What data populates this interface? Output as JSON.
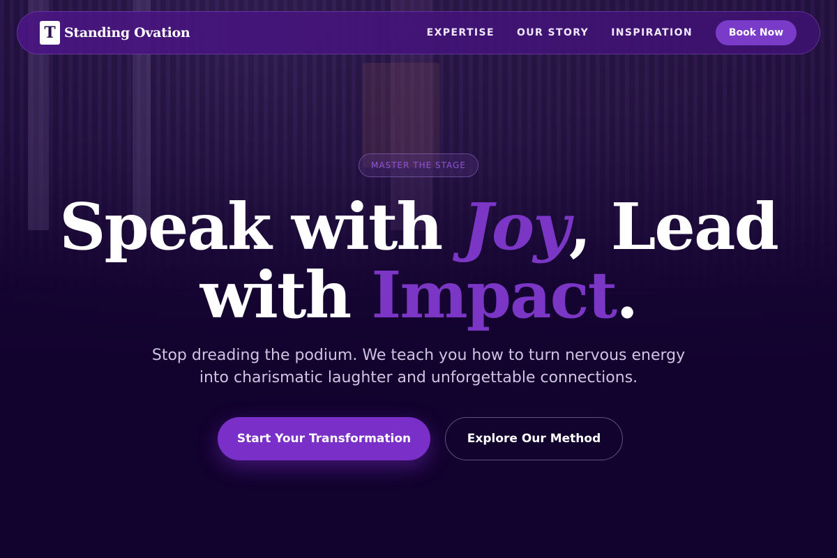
{
  "nav": {
    "logo_letter": "T",
    "brand": "Standing Ovation",
    "links": [
      "EXPERTISE",
      "OUR STORY",
      "INSPIRATION"
    ],
    "cta": "Book Now"
  },
  "hero": {
    "tag": "MASTER THE STAGE",
    "headline": {
      "part1": "Speak with ",
      "accent1": "Joy",
      "part2": ", Lead",
      "part3": "with ",
      "accent2": "Impact",
      "part4": "."
    },
    "subtitle": "Stop dreading the podium. We teach you how to turn nervous energy into charismatic laughter and unforgettable connections.",
    "primary_cta": "Start Your Transformation",
    "secondary_cta": "Explore Our Method"
  },
  "colors": {
    "background": "#12022e",
    "accent": "#7b36c6",
    "nav_button": "#7a3bc9"
  }
}
